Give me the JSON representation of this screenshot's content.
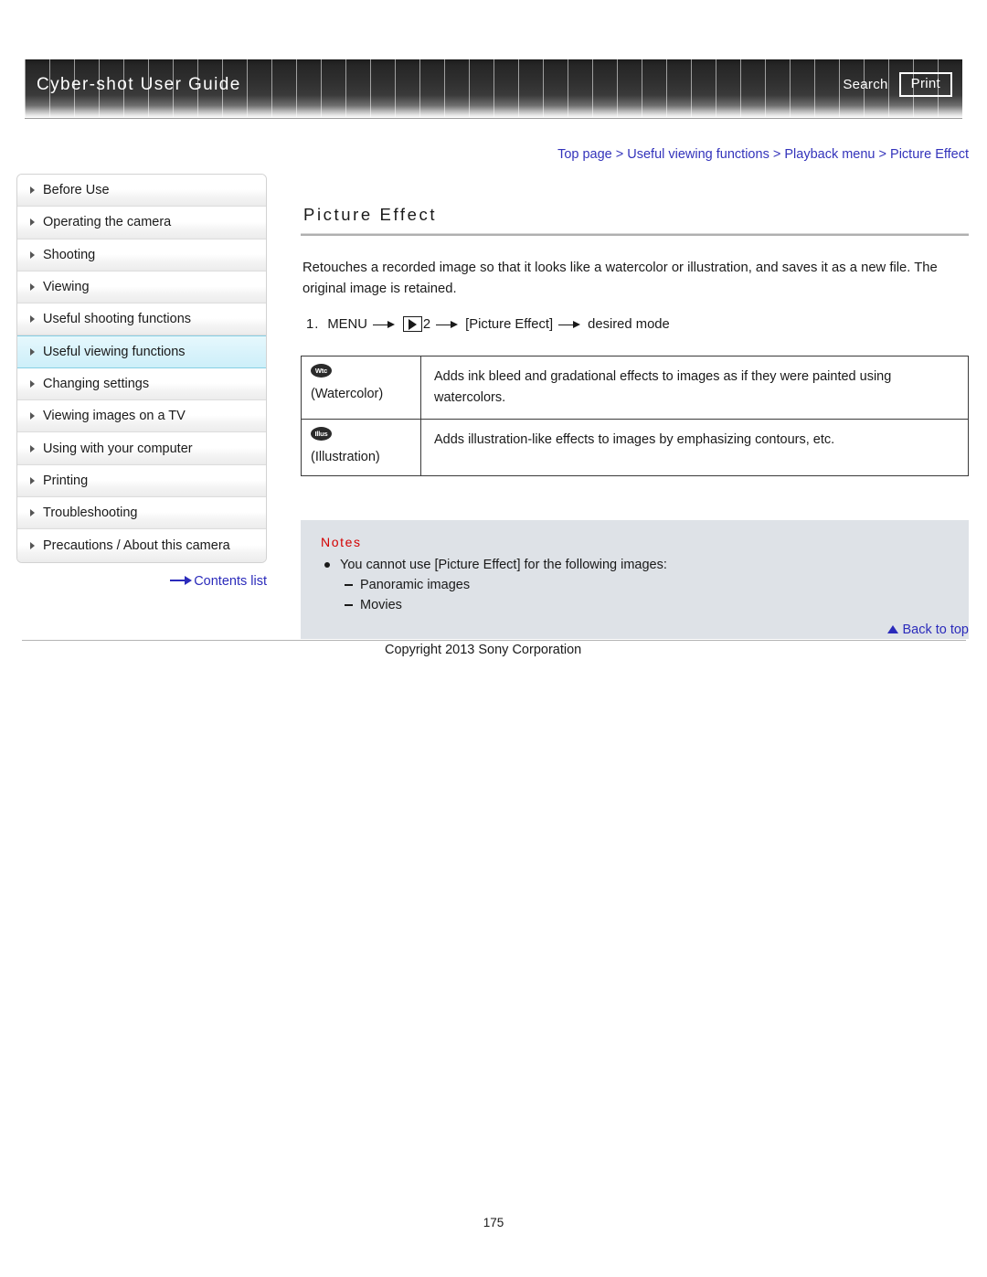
{
  "header": {
    "title": "Cyber-shot User Guide",
    "search_label": "Search",
    "print_label": "Print"
  },
  "breadcrumb": {
    "full": "Top page > Useful viewing functions > Playback menu > Picture Effect",
    "items": [
      "Top page",
      "Useful viewing functions",
      "Playback menu",
      "Picture Effect"
    ],
    "separator": ">"
  },
  "sidebar": {
    "items": [
      {
        "label": "Before Use",
        "active": false
      },
      {
        "label": "Operating the camera",
        "active": false
      },
      {
        "label": "Shooting",
        "active": false
      },
      {
        "label": "Viewing",
        "active": false
      },
      {
        "label": "Useful shooting functions",
        "active": false
      },
      {
        "label": "Useful viewing functions",
        "active": true
      },
      {
        "label": "Changing settings",
        "active": false
      },
      {
        "label": "Viewing images on a TV",
        "active": false
      },
      {
        "label": "Using with your computer",
        "active": false
      },
      {
        "label": "Printing",
        "active": false
      },
      {
        "label": "Troubleshooting",
        "active": false
      },
      {
        "label": "Precautions / About this camera",
        "active": false
      }
    ],
    "contents_link": "Contents list"
  },
  "main": {
    "title": "Picture Effect",
    "intro": "Retouches a recorded image so that it looks like a watercolor or illustration, and saves it as a new file. The original image is retained.",
    "step": {
      "number": "1.",
      "menu_label": "MENU",
      "playback_icon": "playback-icon",
      "menu_page": "2",
      "item_label": "[Picture Effect]",
      "result_label": "desired mode"
    },
    "table": {
      "rows": [
        {
          "badge": "Wtc",
          "mode": "(Watercolor)",
          "description": "Adds ink bleed and gradational effects to images as if they were painted using watercolors."
        },
        {
          "badge": "Illus",
          "mode": "(Illustration)",
          "description": "Adds illustration-like effects to images by emphasizing contours, etc."
        }
      ]
    },
    "notes": {
      "title": "Notes",
      "items": [
        "You cannot use [Picture Effect] for the following images:"
      ],
      "sub_items": [
        "Panoramic images",
        "Movies"
      ]
    }
  },
  "footer": {
    "back_to_top": "Back to top",
    "copyright": "Copyright 2013 Sony Corporation",
    "page_number": "175"
  },
  "colors": {
    "link_blue": "#2b2bbb",
    "breadcrumb_blue": "#3333bb",
    "notes_red": "#d40000",
    "notes_bg": "#dee2e7",
    "active_nav_bg": "#d9f3fb",
    "active_nav_border": "#86cfe4"
  }
}
